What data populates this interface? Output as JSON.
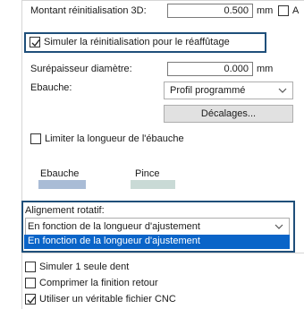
{
  "reset": {
    "label": "Montant réinitialisation 3D:",
    "value": "0.500",
    "unit": "mm",
    "axis_label": "A"
  },
  "simulate_resharpen": {
    "label": "Simuler la réinitialisation pour le réaffûtage",
    "checked": true
  },
  "diameter_overstock": {
    "label": "Surépaisseur diamètre:",
    "value": "0.000",
    "unit": "mm"
  },
  "blank": {
    "label": "Ebauche:",
    "selected": "Profil programmé",
    "offsets_button": "Décalages..."
  },
  "limit_blank_length": {
    "label": "Limiter la longueur de l'ébauche",
    "checked": false
  },
  "color_legend": {
    "blank_label": "Ebauche",
    "chuck_label": "Pince",
    "blank_color": "#a9bcd6",
    "chuck_color": "#c9dad6"
  },
  "rotary_alignment": {
    "label": "Alignement rotatif:",
    "selected": "En fonction de la longueur d'ajustement",
    "options": [
      "En fonction de la longueur d'ajustement"
    ]
  },
  "options": {
    "simulate_one_tooth": {
      "label": "Simuler 1 seule dent",
      "checked": false
    },
    "compress_finish_return": {
      "label": "Comprimer la finition retour",
      "checked": false
    },
    "use_real_cnc": {
      "label": "Utiliser un véritable fichier CNC",
      "checked": true
    }
  },
  "colors": {
    "focus": "#1f4f7a",
    "selection": "#0a64c8"
  }
}
